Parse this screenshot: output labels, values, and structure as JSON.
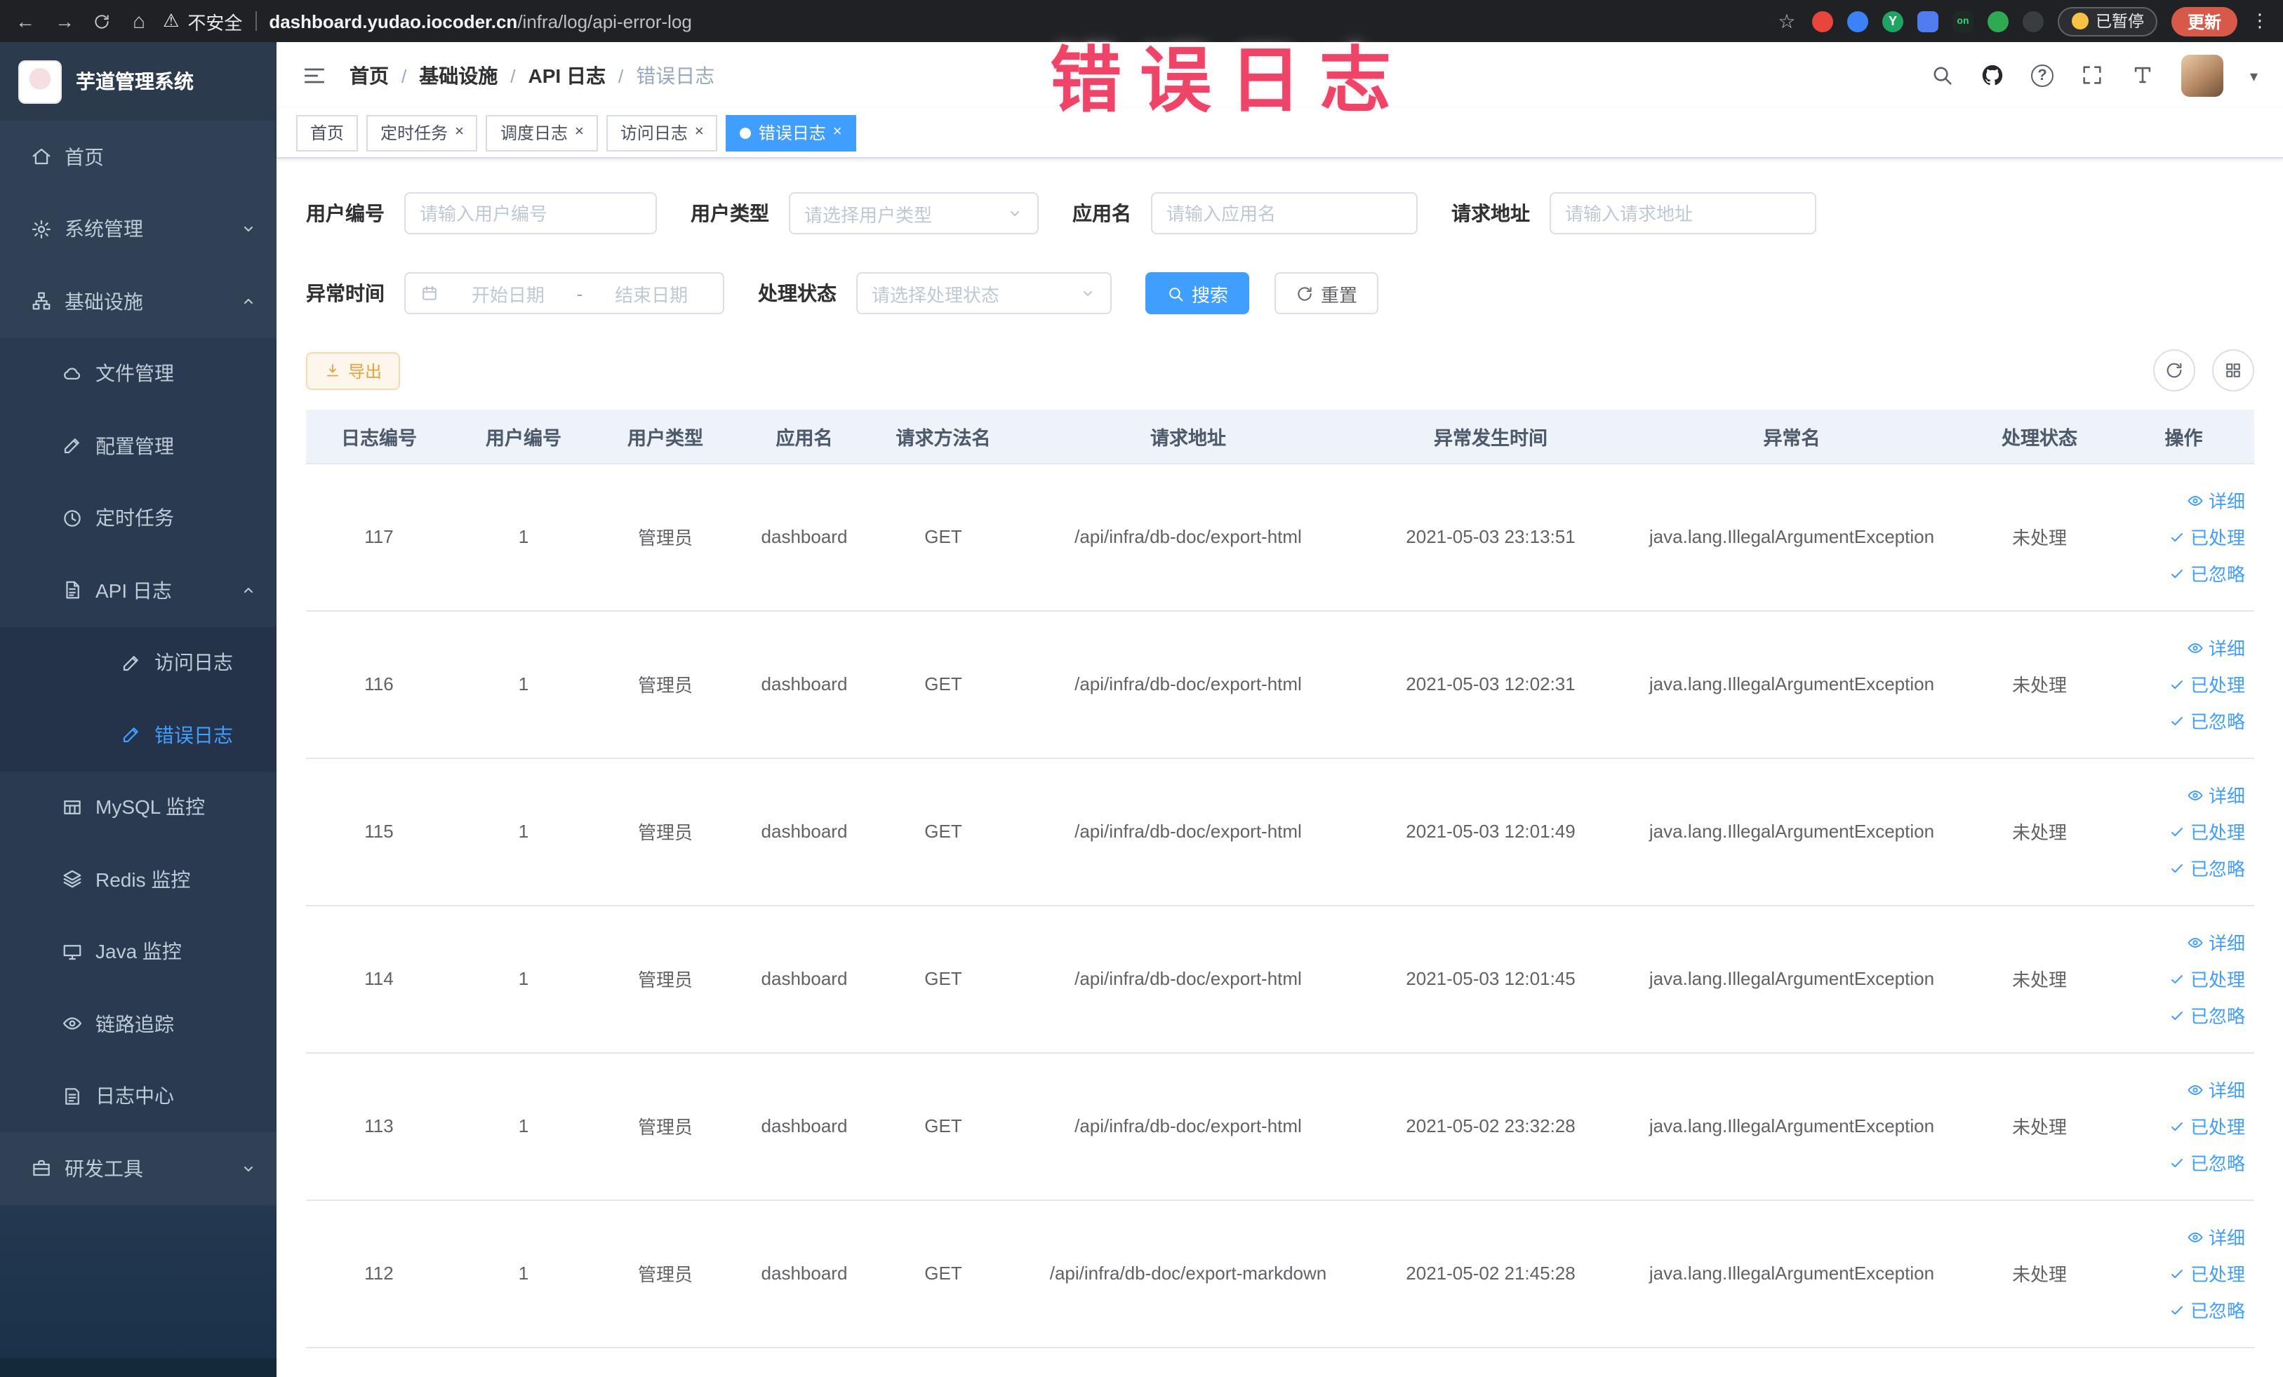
{
  "browser": {
    "security_label": "不安全",
    "url_host": "dashboard.yudao.iocoder.cn",
    "url_path": "/infra/log/api-error-log",
    "paused_badge": "已暂停",
    "update_label": "更新"
  },
  "annotation": "错误日志",
  "sidebar": {
    "title": "芋道管理系统",
    "items": [
      {
        "label": "首页",
        "icon": "home-icon"
      },
      {
        "label": "系统管理",
        "icon": "gear-icon"
      },
      {
        "label": "基础设施",
        "icon": "sitemap-icon"
      },
      {
        "label": "文件管理",
        "icon": "cloud-icon"
      },
      {
        "label": "配置管理",
        "icon": "edit-icon"
      },
      {
        "label": "定时任务",
        "icon": "clock-icon"
      },
      {
        "label": "API 日志",
        "icon": "document-icon"
      },
      {
        "label": "访问日志",
        "icon": "edit-icon"
      },
      {
        "label": "错误日志",
        "icon": "edit-icon"
      },
      {
        "label": "MySQL 监控",
        "icon": "table-icon"
      },
      {
        "label": "Redis 监控",
        "icon": "layers-icon"
      },
      {
        "label": "Java 监控",
        "icon": "monitor-icon"
      },
      {
        "label": "链路追踪",
        "icon": "eye-icon"
      },
      {
        "label": "日志中心",
        "icon": "notebook-icon"
      },
      {
        "label": "研发工具",
        "icon": "briefcase-icon"
      }
    ]
  },
  "breadcrumb": [
    "首页",
    "基础设施",
    "API 日志",
    "错误日志"
  ],
  "tabs": [
    {
      "label": "首页",
      "closable": false,
      "active": false
    },
    {
      "label": "定时任务",
      "closable": true,
      "active": false
    },
    {
      "label": "调度日志",
      "closable": true,
      "active": false
    },
    {
      "label": "访问日志",
      "closable": true,
      "active": false
    },
    {
      "label": "错误日志",
      "closable": true,
      "active": true
    }
  ],
  "filters": {
    "user_id_label": "用户编号",
    "user_id_placeholder": "请输入用户编号",
    "user_type_label": "用户类型",
    "user_type_placeholder": "请选择用户类型",
    "app_name_label": "应用名",
    "app_name_placeholder": "请输入应用名",
    "request_url_label": "请求地址",
    "request_url_placeholder": "请输入请求地址",
    "time_label": "异常时间",
    "time_start_placeholder": "开始日期",
    "time_separator": "-",
    "time_end_placeholder": "结束日期",
    "status_label": "处理状态",
    "status_placeholder": "请选择处理状态",
    "search_label": "搜索",
    "reset_label": "重置"
  },
  "toolbar": {
    "export_label": "导出"
  },
  "table": {
    "columns": [
      "日志编号",
      "用户编号",
      "用户类型",
      "应用名",
      "请求方法名",
      "请求地址",
      "异常发生时间",
      "异常名",
      "处理状态",
      "操作"
    ],
    "actions": {
      "detail": "详细",
      "processed": "已处理",
      "ignored": "已忽略"
    },
    "rows": [
      [
        "117",
        "1",
        "管理员",
        "dashboard",
        "GET",
        "/api/infra/db-doc/export-html",
        "2021-05-03 23:13:51",
        "java.lang.IllegalArgumentException",
        "未处理"
      ],
      [
        "116",
        "1",
        "管理员",
        "dashboard",
        "GET",
        "/api/infra/db-doc/export-html",
        "2021-05-03 12:02:31",
        "java.lang.IllegalArgumentException",
        "未处理"
      ],
      [
        "115",
        "1",
        "管理员",
        "dashboard",
        "GET",
        "/api/infra/db-doc/export-html",
        "2021-05-03 12:01:49",
        "java.lang.IllegalArgumentException",
        "未处理"
      ],
      [
        "114",
        "1",
        "管理员",
        "dashboard",
        "GET",
        "/api/infra/db-doc/export-html",
        "2021-05-03 12:01:45",
        "java.lang.IllegalArgumentException",
        "未处理"
      ],
      [
        "113",
        "1",
        "管理员",
        "dashboard",
        "GET",
        "/api/infra/db-doc/export-html",
        "2021-05-02 23:32:28",
        "java.lang.IllegalArgumentException",
        "未处理"
      ],
      [
        "112",
        "1",
        "管理员",
        "dashboard",
        "GET",
        "/api/infra/db-doc/export-markdown",
        "2021-05-02 21:45:28",
        "java.lang.IllegalArgumentException",
        "未处理"
      ]
    ]
  },
  "colors": {
    "primary": "#409eff",
    "warning": "#e6a23c",
    "sidebar_bg": "#304156",
    "annotation": "#ee4468",
    "active_tab_bg": "#409eff"
  }
}
